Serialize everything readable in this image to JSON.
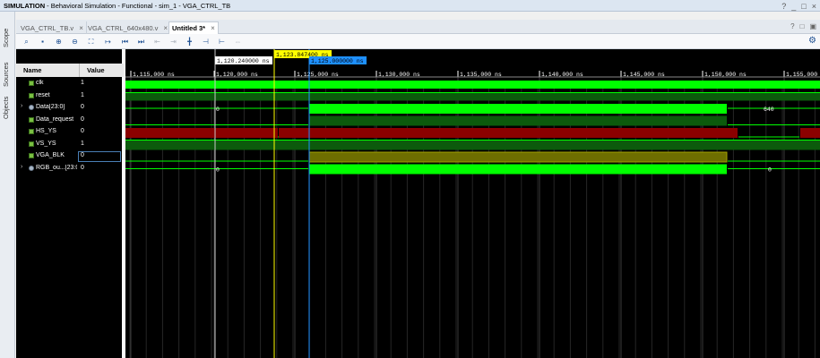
{
  "window": {
    "title_bold": "SIMULATION",
    "title_rest": " - Behavioral Simulation - Functional - sim_1 - VGA_CTRL_TB",
    "controls": [
      "?",
      "_",
      "□",
      "×"
    ]
  },
  "side_tabs": [
    "Scope",
    "Sources",
    "Objects"
  ],
  "tabs": [
    {
      "label": "VGA_CTRL_TB.v",
      "active": false
    },
    {
      "label": "VGA_CTRL_640x480.v",
      "active": false
    },
    {
      "label": "Untitled 3*",
      "active": true
    }
  ],
  "tab_close": "×",
  "tabbar_right": [
    "?",
    "□",
    "▣"
  ],
  "toolbar": {
    "icons": [
      "search-icon",
      "save-icon",
      "zoom-in-icon",
      "zoom-out-icon",
      "zoom-fit-icon",
      "goto-cursor-icon",
      "goto-start-icon",
      "goto-end-icon",
      "prev-transition-icon",
      "next-transition-icon",
      "add-marker-icon",
      "prev-marker-icon",
      "next-marker-icon",
      "swap-cursors-icon"
    ],
    "glyphs": [
      "⌕",
      "▪",
      "⊕",
      "⊖",
      "⛶",
      "↦",
      "⏮",
      "⏭",
      "⇤",
      "⇥",
      "╋",
      "⊣",
      "⊢",
      "⇔"
    ]
  },
  "columns": {
    "name": "Name",
    "value": "Value"
  },
  "signals": [
    {
      "name": "clk",
      "value": "1",
      "bus": false
    },
    {
      "name": "reset",
      "value": "1",
      "bus": false
    },
    {
      "name": "Data[23:0]",
      "value": "0",
      "bus": true
    },
    {
      "name": "Data_request",
      "value": "0",
      "bus": false
    },
    {
      "name": "HS_YS",
      "value": "0",
      "bus": false
    },
    {
      "name": "VS_YS",
      "value": "1",
      "bus": false
    },
    {
      "name": "VGA_BLK",
      "value": "0",
      "bus": false,
      "selected": true
    },
    {
      "name": "RGB_ou...[23:0]",
      "value": "0",
      "bus": true
    }
  ],
  "cursors": {
    "marker1": "1,120.240000 ns",
    "marker2": "1,123.847400 ns",
    "marker3": "1,125.000000 ns"
  },
  "timeline": {
    "ticks": [
      "1,115,000 ns",
      "1,120,000 ns",
      "1,125,000 ns",
      "1,130,000 ns",
      "1,135,000 ns",
      "1,140,000 ns",
      "1,145,000 ns",
      "1,150,000 ns",
      "1,155,000"
    ],
    "bus_values": {
      "data_left": "0",
      "data_right": "640",
      "rgb_left": "0",
      "rgb_right": "0"
    }
  },
  "colors": {
    "signal_green": "#00ff00",
    "dark_green": "#0c5a0c",
    "red": "#8b0000",
    "yellow_bus": "#6e6e00",
    "cursor_yellow": "#ffff00",
    "cursor_blue": "#1e90ff"
  }
}
